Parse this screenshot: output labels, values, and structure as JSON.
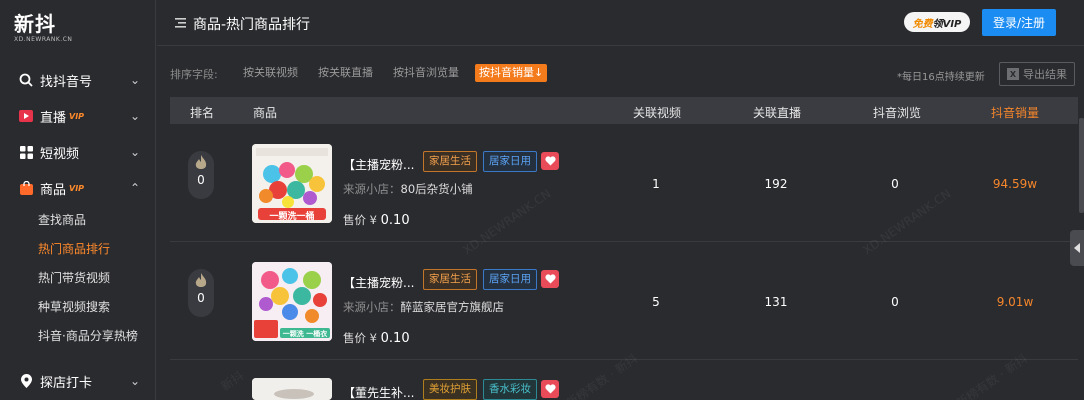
{
  "logo": {
    "mark": "新抖",
    "sub": "XD.NEWRANK.CN"
  },
  "sidebar": {
    "items": [
      {
        "label": "找抖音号",
        "icon": "search-icon",
        "vip": "",
        "chevron": "⌄"
      },
      {
        "label": "直播",
        "icon": "live-icon",
        "vip": "VIP",
        "chevron": "⌄"
      },
      {
        "label": "短视频",
        "icon": "grid-icon",
        "vip": "",
        "chevron": "⌄"
      },
      {
        "label": "商品",
        "icon": "bag-icon",
        "vip": "VIP",
        "chevron": "⌃"
      }
    ],
    "subitems": [
      {
        "label": "查找商品",
        "active": false
      },
      {
        "label": "热门商品排行",
        "active": true
      },
      {
        "label": "热门带货视频",
        "active": false
      },
      {
        "label": "种草视频搜索",
        "active": false
      },
      {
        "label": "抖音·商品分享热榜",
        "active": false
      }
    ],
    "bottom_item": {
      "label": "探店打卡",
      "icon": "location-icon",
      "chevron": "⌄"
    }
  },
  "header": {
    "title": "商品-热门商品排行",
    "vip_badge": {
      "free": "免费",
      "rest": "领VIP"
    },
    "login_label": "登录/注册"
  },
  "sortbar": {
    "label": "排序字段:",
    "options": [
      "按关联视频",
      "按关联直播",
      "按抖音浏览量",
      "按抖音销量"
    ],
    "active_option": "按抖音销量↓",
    "note": "*每日16点持续更新",
    "export_label": "导出结果"
  },
  "table": {
    "headers": [
      "排名",
      "商品",
      "关联视频",
      "关联直播",
      "抖音浏览",
      "抖音销量"
    ],
    "rows": [
      {
        "rank": "0",
        "name": "【主播宠粉...",
        "tags": [
          "家居生活",
          "居家日用"
        ],
        "shop_prefix": "来源小店：",
        "shop": "80后杂货小铺",
        "price_prefix": "售价 ¥ ",
        "price": "0.10",
        "videos": "1",
        "lives": "192",
        "views": "0",
        "sales": "94.59w",
        "thumb_caption": "一颗洗一桶"
      },
      {
        "rank": "0",
        "name": "【主播宠粉...",
        "tags": [
          "家居生活",
          "居家日用"
        ],
        "shop_prefix": "来源小店：",
        "shop": "醉蓝家居官方旗舰店",
        "price_prefix": "售价 ¥ ",
        "price": "0.10",
        "videos": "5",
        "lives": "131",
        "views": "0",
        "sales": "9.01w",
        "thumb_caption": "一颗洗 一桶衣"
      },
      {
        "rank": "",
        "name": "【董先生补...",
        "tags": [
          "美妆护肤",
          "香水彩妆"
        ],
        "shop_prefix": "",
        "shop": "",
        "price_prefix": "",
        "price": "",
        "videos": "",
        "lives": "",
        "views": "",
        "sales": "",
        "thumb_caption": ""
      }
    ]
  },
  "watermarks": [
    "XD.NEWRANK.CN",
    "XD.NEWRANK.CN",
    "新榜有数 · 新抖",
    "新榜有数 · 新抖",
    "新抖"
  ],
  "colors": {
    "accent": "#f47b1c",
    "primary": "#1b8cf2",
    "bg": "#2a2b2f"
  }
}
